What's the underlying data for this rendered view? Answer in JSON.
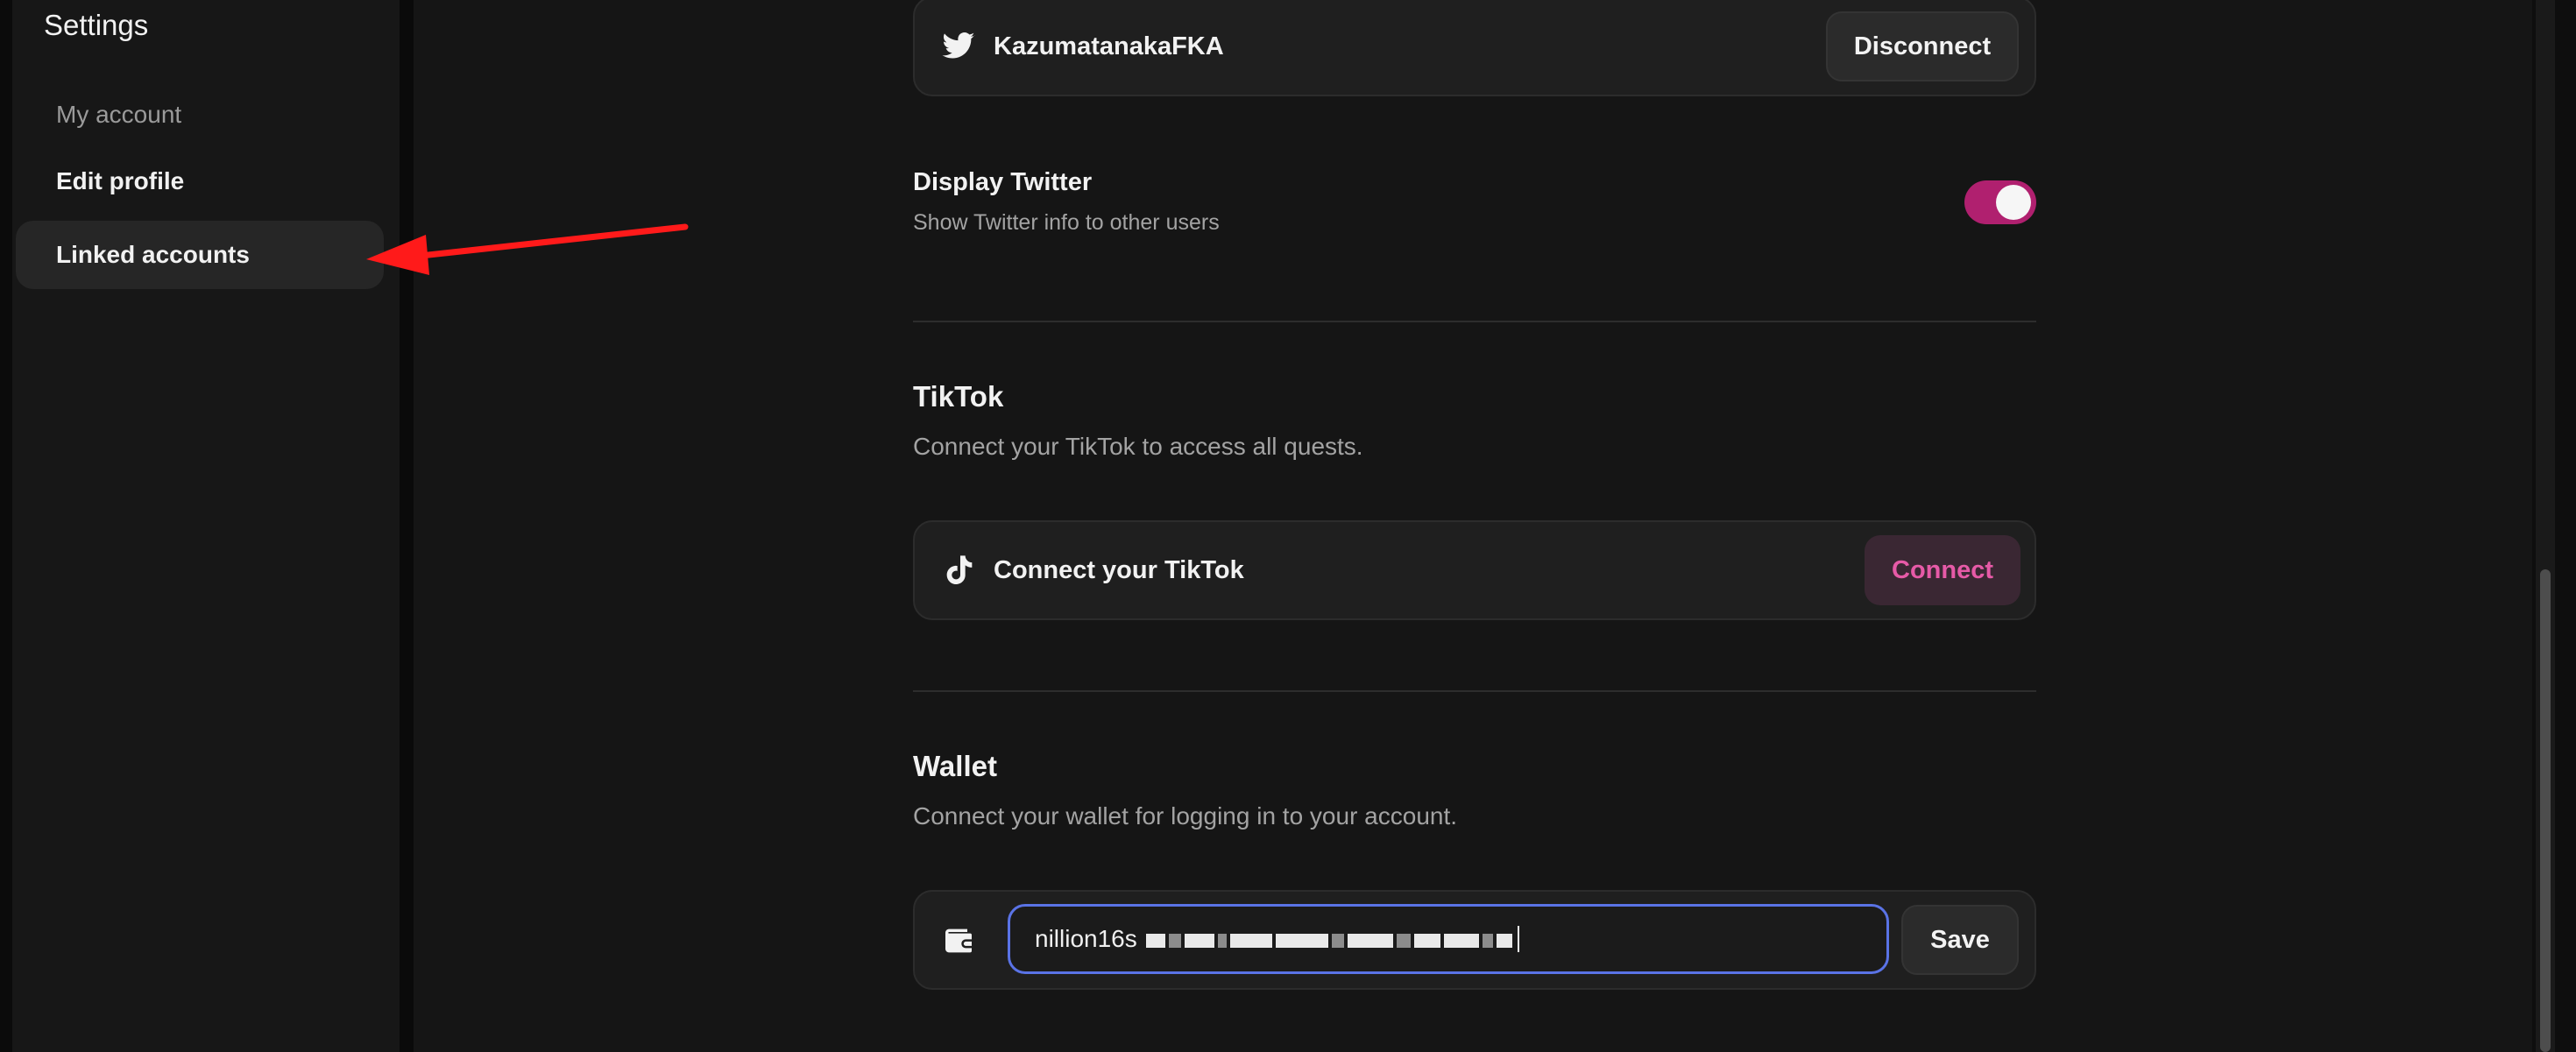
{
  "sidebar": {
    "title": "Settings",
    "items": [
      {
        "label": "My account"
      },
      {
        "label": "Edit profile"
      },
      {
        "label": "Linked accounts"
      }
    ]
  },
  "twitter": {
    "account_name": "KazumatanakaFKA",
    "disconnect_label": "Disconnect",
    "display_label": "Display Twitter",
    "display_desc": "Show Twitter info to other users",
    "display_enabled": true
  },
  "tiktok": {
    "title": "TikTok",
    "desc": "Connect your TikTok to access all quests.",
    "card_label": "Connect your TikTok",
    "connect_label": "Connect"
  },
  "wallet": {
    "title": "Wallet",
    "desc": "Connect your wallet for logging in to your account.",
    "input_value_visible": "nillion16s",
    "save_label": "Save"
  },
  "colors": {
    "accent_pink": "#e65aa7",
    "toggle_on": "#b0206f",
    "focus_blue": "#5a73e6",
    "annotation_red": "#ff1a1a"
  }
}
